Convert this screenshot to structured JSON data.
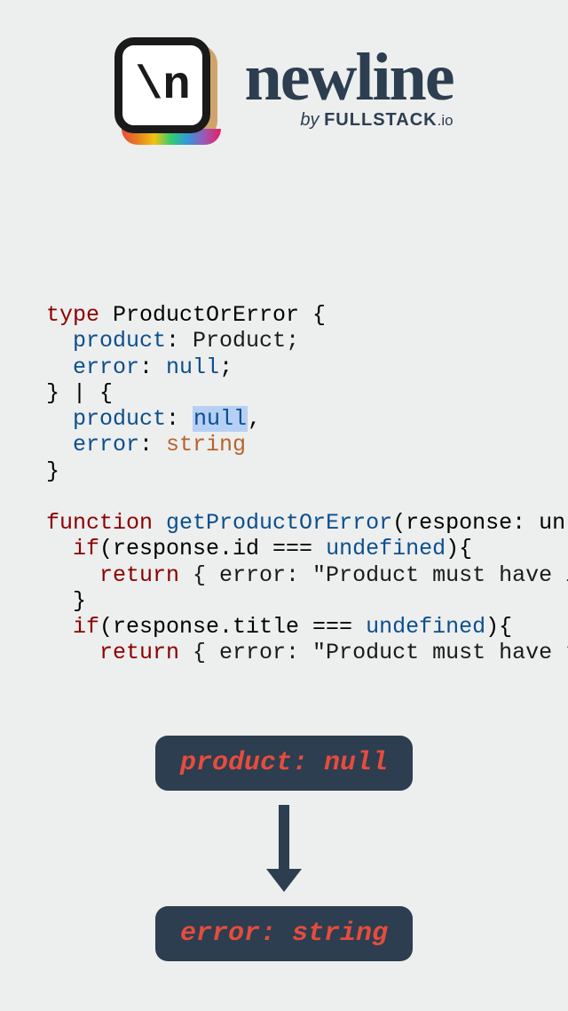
{
  "logo": {
    "glyph": "\\n",
    "brand": "newline",
    "byline_prefix": "by ",
    "byline_strong": "FULLSTACK",
    "byline_tld": ".io"
  },
  "code": {
    "line1_kw": "type",
    "line1_name": " ProductOrError {",
    "line2_prop": "  product",
    "line2_type": " Product;",
    "line3_prop": "  error",
    "line3_null": " null",
    "line4": "} | {",
    "line5_prop": "  product",
    "line5_null_sel": "null",
    "line6_prop": "  error",
    "line6_type": " string",
    "line7": "}",
    "line9_kw": "function",
    "line9_fn": " getProductOrError",
    "line9_params": "(response: unkn",
    "line10_if": "  if",
    "line10_cond_a": "(response.id === ",
    "line10_undef": "undefined",
    "line10_cond_b": "){",
    "line11_return": "    return",
    "line11_body": " { error: \"Product must have id",
    "line12": "  }",
    "line13_if": "  if",
    "line13_cond_a": "(response.title === ",
    "line13_undef": "undefined",
    "line13_cond_b": "){",
    "line14_return": "    return",
    "line14_body": " { error: \"Product must have ti"
  },
  "diagram": {
    "pill1": "product: null",
    "pill2": "error: string"
  },
  "colors": {
    "bg": "#edeeee",
    "pill_bg": "#2c3e50",
    "pill_text": "#e74c3c",
    "keyword": "#8b0000",
    "property": "#0b4f8e"
  }
}
